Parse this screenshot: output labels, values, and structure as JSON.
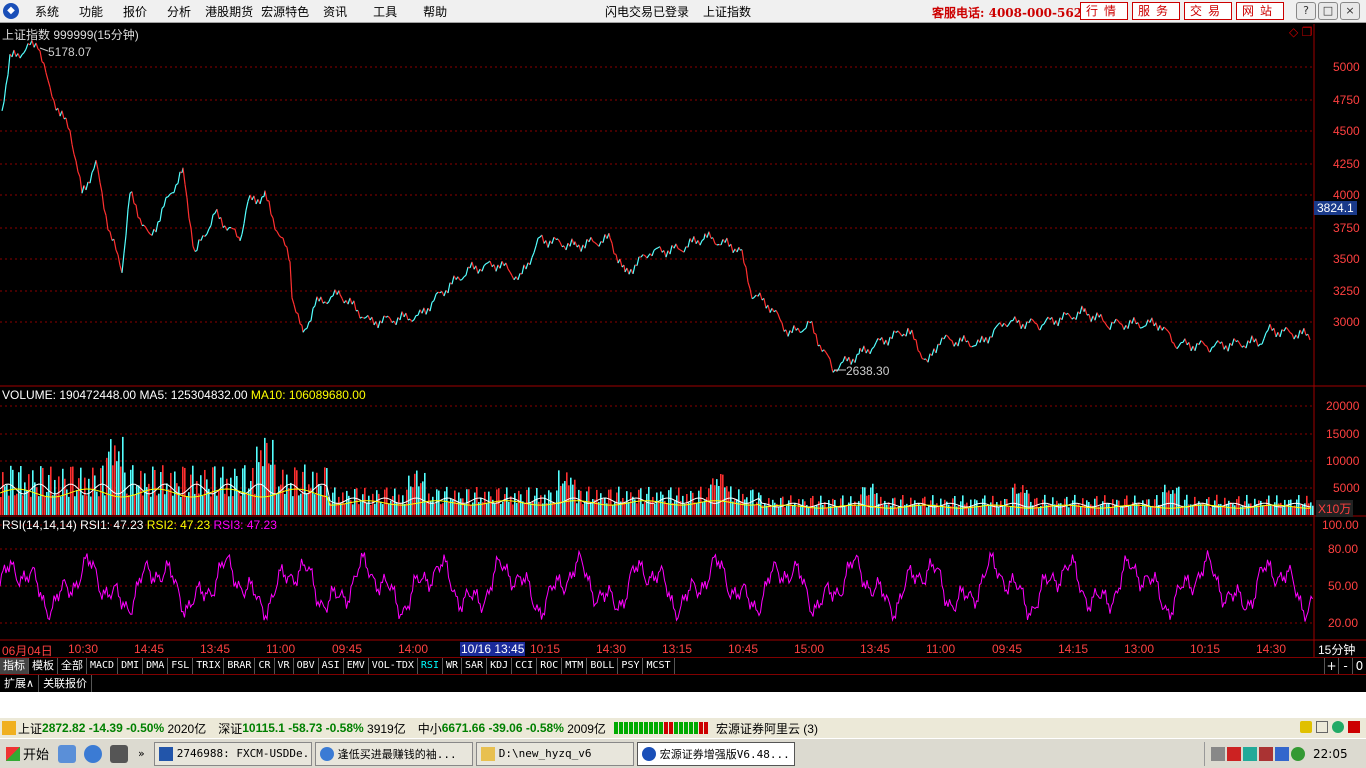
{
  "menu": {
    "items": [
      "系统",
      "功能",
      "报价",
      "分析",
      "港股期货",
      "宏源特色",
      "资讯",
      "工具",
      "帮助"
    ],
    "center_left": "闪电交易已登录",
    "center_right": "上证指数",
    "hotline": "客服电话: 4008-000-562",
    "buttons": [
      "行情",
      "服务",
      "交易",
      "网站"
    ],
    "window_buttons": [
      "?",
      "□",
      "×"
    ]
  },
  "main_chart": {
    "title": "上证指数 999999(15分钟)",
    "high_label": "5178.07",
    "low_label": "2638.30",
    "current_price": "3824.1",
    "y_ticks": [
      "5000",
      "4750",
      "4500",
      "4250",
      "4000",
      "3750",
      "3500",
      "3250",
      "3000"
    ],
    "colors": {
      "up": "#ff3030",
      "down": "#54ffff",
      "grid": "#8b0000"
    }
  },
  "volume": {
    "label": "VOLUME: 190472448.00",
    "ma5": "MA5: 125304832.00",
    "ma10": "MA10: 106089680.00",
    "y_ticks": [
      "20000",
      "15000",
      "10000",
      "5000"
    ],
    "unit": "X10万",
    "colors": {
      "ma5": "#ffff00",
      "ma10": "#ffff00"
    }
  },
  "rsi": {
    "label": "RSI(14,14,14)",
    "rsi1": "RSI1: 47.23",
    "rsi2": "RSI2: 47.23",
    "rsi3": "RSI3: 47.23",
    "y_ticks": [
      "100.00",
      "80.00",
      "50.00",
      "20.00"
    ],
    "colors": {
      "rsi1": "#ffffff",
      "rsi2": "#ffff00",
      "rsi3": "#ff00ff"
    }
  },
  "time_axis": {
    "labels": [
      "06月04日",
      "10:30",
      "14:45",
      "13:45",
      "11:00",
      "09:45",
      "14:00",
      "10/16 13:45",
      "10:15",
      "14:30",
      "13:15",
      "10:45",
      "15:00",
      "13:45",
      "11:00",
      "09:45",
      "14:15",
      "13:00",
      "10:15",
      "14:30"
    ],
    "period": "15分钟"
  },
  "indicator_tabs": [
    "指标",
    "模板",
    "全部",
    "MACD",
    "DMI",
    "DMA",
    "FSL",
    "TRIX",
    "BRAR",
    "CR",
    "VR",
    "OBV",
    "ASI",
    "EMV",
    "VOL-TDX",
    "RSI",
    "WR",
    "SAR",
    "KDJ",
    "CCI",
    "ROC",
    "MTM",
    "BOLL",
    "PSY",
    "MCST"
  ],
  "indicator_controls": [
    "+",
    "-",
    "0"
  ],
  "ext_tabs": [
    "扩展∧",
    "关联报价"
  ],
  "status": {
    "sh_name": "上证",
    "sh_value": "2872.82",
    "sh_change": "-14.39",
    "sh_pct": "-0.50%",
    "sh_amount": "2020亿",
    "sz_name": "深证",
    "sz_value": "10115.1",
    "sz_change": "-58.73",
    "sz_pct": "-0.58%",
    "sz_amount": "3919亿",
    "zx_name": "中小",
    "zx_value": "6671.66",
    "zx_change": "-39.06",
    "zx_pct": "-0.58%",
    "zx_amount": "2009亿",
    "broker": "宏源证券阿里云 (3)"
  },
  "taskbar": {
    "start": "开始",
    "tasks": [
      "2746988: FXCM-USDDe...",
      "逢低买进最赚钱的袖...",
      "D:\\new_hyzq_v6",
      "宏源证券增强版V6.48..."
    ],
    "clock": "22:05"
  }
}
